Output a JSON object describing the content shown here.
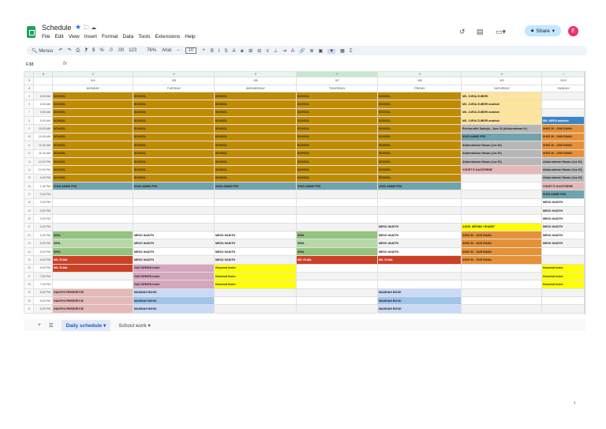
{
  "app": {
    "title": "Schedule",
    "menu": [
      "File",
      "Edit",
      "View",
      "Insert",
      "Format",
      "Data",
      "Tools",
      "Extensions",
      "Help"
    ],
    "share_label": "Share",
    "avatar_letter": "E"
  },
  "toolbar": {
    "search": "Menus",
    "zoom": "76%",
    "font": "Arial",
    "font_size": "10",
    "items": [
      "↶",
      "↷",
      "⎙",
      "⁋",
      "$",
      "%",
      ".0",
      ".00",
      "123",
      "B",
      "I",
      "S",
      "A",
      "◈",
      "⊞",
      "⊟",
      "≡",
      "⊥",
      "⇥",
      "A",
      "🔗",
      "⊕",
      "▣",
      "▼",
      "▦",
      "Σ"
    ]
  },
  "formula_bar": {
    "cell_ref": "F38",
    "fx": "fx"
  },
  "columns": [
    "",
    "B",
    "C",
    "D",
    "E",
    "F",
    "G",
    "H",
    "I"
  ],
  "days": [
    {
      "date": "9/4",
      "name": "MONDAY"
    },
    {
      "date": "9/5",
      "name": "TUESDAY"
    },
    {
      "date": "9/6",
      "name": "WEDNESDAY"
    },
    {
      "date": "9/7",
      "name": "THURSDAY"
    },
    {
      "date": "9/8",
      "name": "FRIDAY"
    },
    {
      "date": "9/9",
      "name": "SATURDAY"
    },
    {
      "date": "9/10",
      "name": "SUNDAY"
    }
  ],
  "colors": {
    "S": "#bf8b00",
    "T": "#6fa3ad",
    "G": "#93c47d",
    "LG": "#b6d7a8",
    "R": "#cc4125",
    "P": "#e6b8b8",
    "M": "#d5a6bd",
    "LB": "#c9daf8",
    "B": "#9fc5e8",
    "Y": "#ffff00",
    "LY": "#ffe599",
    "GR": "#b7b7b7",
    "O": "#e69138",
    "DB": "#3d85c6"
  },
  "rows": [
    {
      "n": "5",
      "time": "8:00 AM",
      "cells": [
        [
          "SCHOOL",
          "S"
        ],
        [
          "SCHOOL",
          "S"
        ],
        [
          "SCHOOL",
          "S"
        ],
        [
          "SCHOOL",
          "S"
        ],
        [
          "SCHOOL",
          "S"
        ],
        [
          "MS. JURIA ZUBERI",
          "LY"
        ],
        [
          "",
          ""
        ]
      ]
    },
    {
      "n": "6",
      "time": "8:30 AM",
      "cells": [
        [
          "SCHOOL",
          "S"
        ],
        [
          "SCHOOL",
          "S"
        ],
        [
          "SCHOOL",
          "S"
        ],
        [
          "SCHOOL",
          "S"
        ],
        [
          "SCHOOL",
          "S"
        ],
        [
          "MS. JURIA ZUBERI arabishi",
          "LY"
        ],
        [
          "",
          ""
        ]
      ]
    },
    {
      "n": "7",
      "time": "9:00 AM",
      "cells": [
        [
          "SCHOOL",
          "S"
        ],
        [
          "SCHOOL",
          "S"
        ],
        [
          "SCHOOL",
          "S"
        ],
        [
          "SCHOOL",
          "S"
        ],
        [
          "SCHOOL",
          "S"
        ],
        [
          "MS. JURIA ZUBERI arabishi",
          "LY"
        ],
        [
          "",
          ""
        ]
      ]
    },
    {
      "n": "8",
      "time": "9:30 AM",
      "cells": [
        [
          "SCHOOL",
          "S"
        ],
        [
          "SCHOOL",
          "S"
        ],
        [
          "SCHOOL",
          "S"
        ],
        [
          "SCHOOL",
          "S"
        ],
        [
          "SCHOOL",
          "S"
        ],
        [
          "MS. JURIA ZUBERI arabishi",
          "LY"
        ],
        [
          "MS. ARIFA arabishi",
          "DB"
        ]
      ]
    },
    {
      "n": "9",
      "time": "10:00 AM",
      "cells": [
        [
          "SCHOOL",
          "S"
        ],
        [
          "SCHOOL",
          "S"
        ],
        [
          "SCHOOL",
          "S"
        ],
        [
          "SCHOOL",
          "S"
        ],
        [
          "SCHOOL",
          "S"
        ],
        [
          "Review with Sabeyla , Jazz 30 (Abdurrahman H.)",
          "GR"
        ],
        [
          "XHIZI 30 - ONS RAMA",
          "O"
        ]
      ]
    },
    {
      "n": "10",
      "time": "10:30 AM",
      "cells": [
        [
          "SCHOOL",
          "S"
        ],
        [
          "SCHOOL",
          "S"
        ],
        [
          "SCHOOL",
          "S"
        ],
        [
          "SCHOOL",
          "S"
        ],
        [
          "SCHOOL",
          "S"
        ],
        [
          "XHIZI AMME PRS",
          "T"
        ],
        [
          "XHIZI 30 - ONS RAMA",
          "O"
        ]
      ]
    },
    {
      "n": "11",
      "time": "11:00 AM",
      "cells": [
        [
          "SCHOOL",
          "S"
        ],
        [
          "SCHOOL",
          "S"
        ],
        [
          "SCHOOL",
          "S"
        ],
        [
          "SCHOOL",
          "S"
        ],
        [
          "SCHOOL",
          "S"
        ],
        [
          "Abdurrahman Hasan (Juz 30)",
          "GR"
        ],
        [
          "XHIZI 30 - ONS RAMA",
          "O"
        ]
      ]
    },
    {
      "n": "12",
      "time": "11:30 AM",
      "cells": [
        [
          "SCHOOL",
          "S"
        ],
        [
          "SCHOOL",
          "S"
        ],
        [
          "SCHOOL",
          "S"
        ],
        [
          "SCHOOL",
          "S"
        ],
        [
          "SCHOOL",
          "S"
        ],
        [
          "Abdurrahman Hasan (Juz 30)",
          "GR"
        ],
        [
          "XHIZI 30 - ONS RAMA",
          "O"
        ]
      ]
    },
    {
      "n": "13",
      "time": "12:00 PM",
      "cells": [
        [
          "SCHOOL",
          "S"
        ],
        [
          "SCHOOL",
          "S"
        ],
        [
          "SCHOOL",
          "S"
        ],
        [
          "SCHOOL",
          "S"
        ],
        [
          "SCHOOL",
          "S"
        ],
        [
          "Abdurrahman Hasan (Juz 30)",
          "GR"
        ],
        [
          "Abdurrahman Hasan (Juz 30)",
          "GR"
        ]
      ]
    },
    {
      "n": "14",
      "time": "12:30 PM",
      "cells": [
        [
          "SCHOOL",
          "S"
        ],
        [
          "SCHOOL",
          "S"
        ],
        [
          "SCHOOL",
          "S"
        ],
        [
          "SCHOOL",
          "S"
        ],
        [
          "SCHOOL",
          "S"
        ],
        [
          "VOKET E KAGITHENE",
          "P"
        ],
        [
          "Abdurrahman Hasan (Juz 30)",
          "GR"
        ]
      ]
    },
    {
      "n": "15",
      "time": "1:00 PM",
      "cells": [
        [
          "SCHOOL",
          "S"
        ],
        [
          "SCHOOL",
          "S"
        ],
        [
          "SCHOOL",
          "S"
        ],
        [
          "SCHOOL",
          "S"
        ],
        [
          "SCHOOL",
          "S"
        ],
        [
          "",
          ""
        ],
        [
          "Abdurrahman Hasan (Juz 30)",
          "GR"
        ]
      ]
    },
    {
      "n": "16",
      "time": "1:30 PM",
      "cells": [
        [
          "XHIZI AMME PRS",
          "T"
        ],
        [
          "XHIZI AMME PRS",
          "T"
        ],
        [
          "XHIZI AMME PRS",
          "T"
        ],
        [
          "XHIZI AMME PRS",
          "T"
        ],
        [
          "XHIZI AMME PRS",
          "T"
        ],
        [
          "",
          ""
        ],
        [
          "VOKET E KAGITHENE",
          "P"
        ]
      ]
    },
    {
      "n": "17",
      "time": "2:00 PM",
      "cells": [
        [
          "",
          ""
        ],
        [
          "",
          ""
        ],
        [
          "",
          ""
        ],
        [
          "",
          ""
        ],
        [
          "",
          ""
        ],
        [
          "",
          ""
        ],
        [
          "XHIZI AMME PRS",
          "T"
        ]
      ]
    },
    {
      "n": "18",
      "time": "2:30 PM",
      "cells": [
        [
          "",
          ""
        ],
        [
          "",
          ""
        ],
        [
          "",
          ""
        ],
        [
          "",
          ""
        ],
        [
          "",
          ""
        ],
        [
          "",
          ""
        ],
        [
          "MESO HADITH",
          ""
        ]
      ]
    },
    {
      "n": "19",
      "time": "3:00 PM",
      "cells": [
        [
          "",
          ""
        ],
        [
          "",
          ""
        ],
        [
          "",
          ""
        ],
        [
          "",
          ""
        ],
        [
          "",
          ""
        ],
        [
          "",
          ""
        ],
        [
          "MESO HADITH",
          ""
        ]
      ]
    },
    {
      "n": "20",
      "time": "3:30 PM",
      "cells": [
        [
          "",
          ""
        ],
        [
          "",
          ""
        ],
        [
          "",
          ""
        ],
        [
          "",
          ""
        ],
        [
          "",
          ""
        ],
        [
          "",
          ""
        ],
        [
          "MESO HADITH",
          ""
        ]
      ]
    },
    {
      "n": "21",
      "time": "4:00 PM",
      "cells": [
        [
          "",
          ""
        ],
        [
          "",
          ""
        ],
        [
          "",
          ""
        ],
        [
          "",
          ""
        ],
        [
          "MESO HADITH",
          ""
        ],
        [
          "ASUE, MESIMI I SHABIT",
          "Y"
        ],
        [
          "MESO HADITH",
          ""
        ]
      ]
    },
    {
      "n": "22",
      "time": "4:30 PM",
      "cells": [
        [
          "SIRA",
          "G"
        ],
        [
          "MESO HADITH",
          ""
        ],
        [
          "MESO HADITH",
          ""
        ],
        [
          "SIRA",
          "G"
        ],
        [
          "MESO HADITH",
          ""
        ],
        [
          "XHIZI 30 - ONS RAMA",
          "O"
        ],
        [
          "MESO HADITH",
          ""
        ]
      ]
    },
    {
      "n": "23",
      "time": "5:00 PM",
      "cells": [
        [
          "SIRA",
          "LG"
        ],
        [
          "MESO HADITH",
          ""
        ],
        [
          "MESO HADITH",
          ""
        ],
        [
          "SIRA",
          "LG"
        ],
        [
          "MESO HADITH",
          ""
        ],
        [
          "XHIZI 30 - ONS RAMA",
          "O"
        ],
        [
          "MESO HADITH",
          ""
        ]
      ]
    },
    {
      "n": "24",
      "time": "5:30 PM",
      "cells": [
        [
          "SIRA",
          "G"
        ],
        [
          "MESO HADITH",
          ""
        ],
        [
          "MESO HADITH",
          ""
        ],
        [
          "SIRA",
          "G"
        ],
        [
          "MESO HADITH",
          ""
        ],
        [
          "XHIZI 30 - ONS RAMA",
          "O"
        ],
        [
          "",
          ""
        ]
      ]
    },
    {
      "n": "25",
      "time": "6:00 PM",
      "cells": [
        [
          "MS. ELMA",
          "R"
        ],
        [
          "MESO HADITH",
          ""
        ],
        [
          "MESO HADITH",
          ""
        ],
        [
          "MS. ELMA",
          "R"
        ],
        [
          "MS. ELMA",
          "R"
        ],
        [
          "XHIZI 30 - ONS RAMA",
          "O"
        ],
        [
          "",
          ""
        ]
      ]
    },
    {
      "n": "26",
      "time": "6:30 PM",
      "cells": [
        [
          "MS. ELMA",
          "R"
        ],
        [
          "GAD SEMIYA lesim",
          "M"
        ],
        [
          "Hosnesit losim",
          "Y"
        ],
        [
          "",
          ""
        ],
        [
          "",
          ""
        ],
        [
          "",
          ""
        ],
        [
          "Hosnesit losim",
          "Y"
        ]
      ]
    },
    {
      "n": "27",
      "time": "7:00 PM",
      "cells": [
        [
          "",
          ""
        ],
        [
          "GAD SEMIYA lesim",
          "M"
        ],
        [
          "Hosnesit losim",
          "Y"
        ],
        [
          "",
          ""
        ],
        [
          "",
          ""
        ],
        [
          "",
          ""
        ],
        [
          "Hosnesit losim",
          "Y"
        ]
      ]
    },
    {
      "n": "28",
      "time": "7:30 PM",
      "cells": [
        [
          "",
          ""
        ],
        [
          "GAD SEMIYA lesim",
          "M"
        ],
        [
          "Hosnesit losim",
          "Y"
        ],
        [
          "",
          ""
        ],
        [
          "",
          ""
        ],
        [
          "",
          ""
        ],
        [
          "Hosnesit losim",
          "Y"
        ]
      ]
    },
    {
      "n": "29",
      "time": "8:00 PM",
      "cells": [
        [
          "HADITHI PERSERITJE",
          "P"
        ],
        [
          "MADINAH BOOK",
          "LB"
        ],
        [
          "",
          ""
        ],
        [
          "",
          ""
        ],
        [
          "MADINAH BOOK",
          "LB"
        ],
        [
          "",
          ""
        ],
        [
          "",
          ""
        ]
      ]
    },
    {
      "n": "30",
      "time": "8:30 PM",
      "cells": [
        [
          "HADITHI PERSERITJE",
          "P"
        ],
        [
          "MADINAH BOOK",
          "B"
        ],
        [
          "",
          ""
        ],
        [
          "",
          ""
        ],
        [
          "MADINAH BOOK",
          "B"
        ],
        [
          "",
          ""
        ],
        [
          "",
          ""
        ]
      ]
    },
    {
      "n": "31",
      "time": "9:00 PM",
      "cells": [
        [
          "HADITHI PERSERITJE",
          "P"
        ],
        [
          "MADINAH BOOK",
          "LB"
        ],
        [
          "",
          ""
        ],
        [
          "",
          ""
        ],
        [
          "MADINAH BOOK",
          "LB"
        ],
        [
          "",
          ""
        ],
        [
          "",
          ""
        ]
      ]
    }
  ],
  "sheet_tabs": [
    {
      "label": "Daily schedule",
      "active": true
    },
    {
      "label": "School work",
      "active": false
    }
  ]
}
